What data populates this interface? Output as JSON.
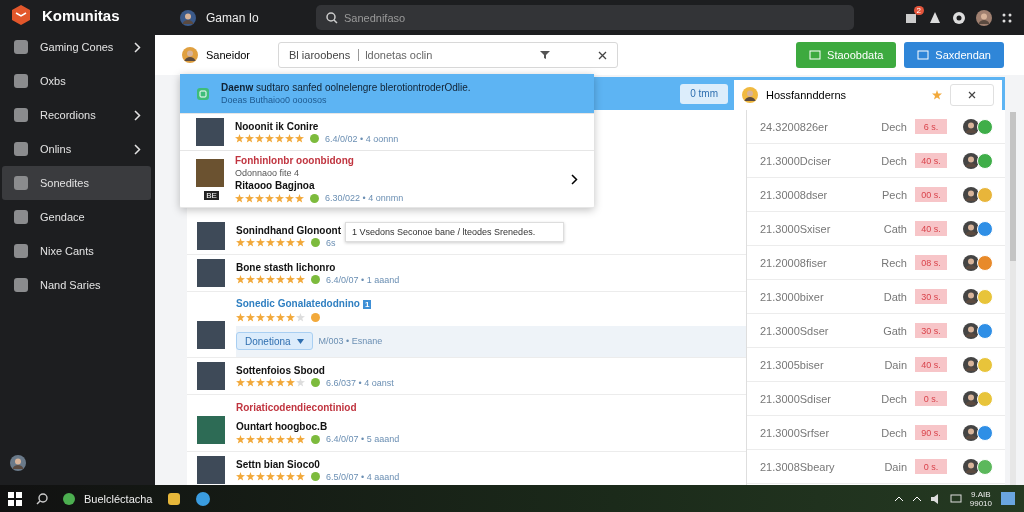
{
  "sidebar": {
    "logo": "Komunitas",
    "items": [
      {
        "label": "Gaming Cones",
        "selected": false,
        "has_chevron": true
      },
      {
        "label": "Oxbs",
        "selected": false,
        "has_chevron": false
      },
      {
        "label": "Recordions",
        "selected": false,
        "has_chevron": true
      },
      {
        "label": "Onlins",
        "selected": false,
        "has_chevron": true
      },
      {
        "label": "Sonedites",
        "selected": true,
        "has_chevron": false
      },
      {
        "label": "Gendace",
        "selected": false,
        "has_chevron": false
      },
      {
        "label": "Nixe Cants",
        "selected": false,
        "has_chevron": false
      },
      {
        "label": "Nand Saries",
        "selected": false,
        "has_chevron": false
      }
    ]
  },
  "topbar": {
    "title": "Gaman Io",
    "search": {
      "placeholder": "Sanednifaso"
    },
    "notification_count": "2"
  },
  "header": {
    "title": "Saneidor",
    "filter": {
      "value": "Bl iaroobens",
      "hint": "ldonetas oclin"
    },
    "buttons": [
      {
        "label": "Staoobdata",
        "kind": "green"
      },
      {
        "label": "Saxdendan",
        "kind": "blue"
      }
    ]
  },
  "list_header": {
    "button": "0 tmm",
    "panel_title": "Hossfanndderns"
  },
  "dropdown": {
    "items": [
      {
        "kind": "notice",
        "title": "Daenw",
        "text": "sudtaro sanfed oolnelengre blerotiontroderOdlie.",
        "subtext": "Doeas Buthaioo0 oooosos",
        "selected": true
      },
      {
        "kind": "game",
        "title": "Nooonit ik Conire",
        "stars": 7,
        "meta": "6.4/0/02 • 4 oonnn",
        "selected": false
      },
      {
        "kind": "feature",
        "headline": "Fonhinlonbr ooonbidong",
        "subtitle": "Odonnaoo fite 4",
        "title": "Ritaooo Bagjnoa",
        "stars": 7,
        "meta": "6.30/022 • 4 onnmn",
        "tag": "BE",
        "selected": false
      }
    ]
  },
  "tooltip": "1 Vsedons Seconoe bane / lteodes Srenedes.",
  "rows": [
    {
      "kind": "plain",
      "title": "Sonindhand Glonoont",
      "stars": 7,
      "meta": "6s"
    },
    {
      "kind": "plain",
      "title": "Bone stasth lichonro",
      "stars": 7,
      "meta": "6.4/0/07 • 1 aaand"
    },
    {
      "kind": "blue",
      "title": "Sonedic Gonalatedodnino",
      "tag": "1",
      "stars": 6,
      "select": "Donetiona",
      "meta": "M/003 • Esnane"
    },
    {
      "kind": "plain",
      "title": "Sottenfoios Sbood",
      "stars": 6,
      "meta": "6.6/037 • 4 oanst"
    },
    {
      "kind": "feature",
      "headline": "Roriaticodendiecontiniod",
      "title": "Ountart hoogboc.B",
      "stars": 7,
      "meta": "6.4/0/07 • 5 aaand"
    },
    {
      "kind": "plain",
      "title": "Settn bian Sioco0",
      "stars": 7,
      "meta": "6.5/0/07 • 4 aaand"
    }
  ],
  "entries": [
    {
      "date": "24.3200826er",
      "label": "Dech",
      "badge": "6 s.",
      "color": "#3fae49"
    },
    {
      "date": "21.3000Dciser",
      "label": "Dech",
      "badge": "40 s.",
      "color": "#3fae49"
    },
    {
      "date": "21.30008dser",
      "label": "Pech",
      "badge": "00 s.",
      "color": "#e8b53a"
    },
    {
      "date": "21.3000Sxiser",
      "label": "Cath",
      "badge": "40 s.",
      "color": "#2f8fe6"
    },
    {
      "date": "21.20008fiser",
      "label": "Rech",
      "badge": "08 s.",
      "color": "#e88a2a"
    },
    {
      "date": "21.3000bixer",
      "label": "Dath",
      "badge": "30 s.",
      "color": "#e8c43a"
    },
    {
      "date": "21.3000Sdser",
      "label": "Gath",
      "badge": "30 s.",
      "color": "#2f8fe6"
    },
    {
      "date": "21.3005biser",
      "label": "Dain",
      "badge": "40 s.",
      "color": "#e8c43a"
    },
    {
      "date": "21.3000Sdiser",
      "label": "Dech",
      "badge": "0 s.",
      "color": "#e8c43a"
    },
    {
      "date": "21.3000Srfser",
      "label": "Dech",
      "badge": "90 s.",
      "color": "#2f8fe6"
    },
    {
      "date": "21.3008Sbeary",
      "label": "Dain",
      "badge": "0 s.",
      "color": "#5cb85c"
    }
  ],
  "taskbar": {
    "app_label": "Buelcléctacha",
    "clock_time": "9.AIB",
    "clock_date": "99010"
  }
}
